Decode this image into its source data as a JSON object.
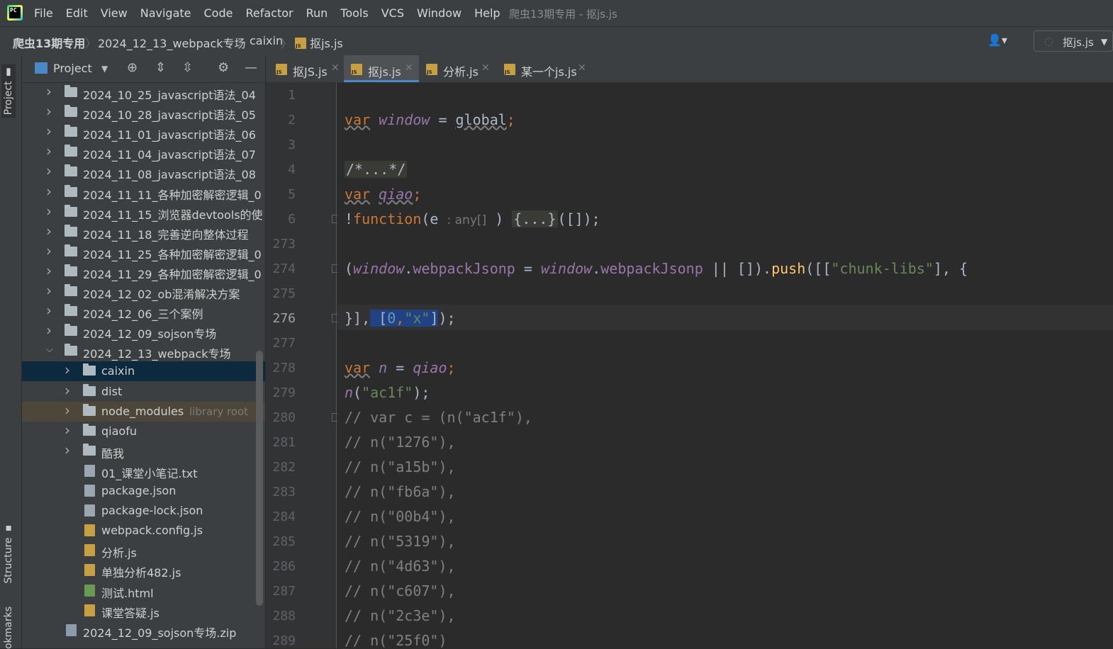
{
  "menubar": {
    "items": [
      "File",
      "Edit",
      "View",
      "Navigate",
      "Code",
      "Refactor",
      "Run",
      "Tools",
      "VCS",
      "Window",
      "Help"
    ],
    "window_title": "爬虫13期专用 - 抠js.js"
  },
  "navbar": {
    "breadcrumbs": [
      "爬虫13期专用",
      "2024_12_13_webpack专场",
      "caixin",
      "抠js.js"
    ],
    "run_config": "抠js.js"
  },
  "side_tabs": {
    "project": "Project",
    "structure": "Structure",
    "bookmarks": "okmarks"
  },
  "project_panel": {
    "title": "Project",
    "rows": [
      {
        "label": "2024_10_25_javascript语法_04",
        "type": "folder",
        "indent": 0,
        "expanded": false
      },
      {
        "label": "2024_10_28_javascript语法_05",
        "type": "folder",
        "indent": 0,
        "expanded": false
      },
      {
        "label": "2024_11_01_javascript语法_06",
        "type": "folder",
        "indent": 0,
        "expanded": false
      },
      {
        "label": "2024_11_04_javascript语法_07",
        "type": "folder",
        "indent": 0,
        "expanded": false
      },
      {
        "label": "2024_11_08_javascript语法_08",
        "type": "folder",
        "indent": 0,
        "expanded": false
      },
      {
        "label": "2024_11_11_各种加密解密逻辑_0",
        "type": "folder",
        "indent": 0,
        "expanded": false
      },
      {
        "label": "2024_11_15_浏览器devtools的使",
        "type": "folder",
        "indent": 0,
        "expanded": false
      },
      {
        "label": "2024_11_18_完善逆向整体过程",
        "type": "folder",
        "indent": 0,
        "expanded": false
      },
      {
        "label": "2024_11_25_各种加密解密逻辑_0",
        "type": "folder",
        "indent": 0,
        "expanded": false
      },
      {
        "label": "2024_11_29_各种加密解密逻辑_0",
        "type": "folder",
        "indent": 0,
        "expanded": false
      },
      {
        "label": "2024_12_02_ob混淆解决方案",
        "type": "folder",
        "indent": 0,
        "expanded": false
      },
      {
        "label": "2024_12_06_三个案例",
        "type": "folder",
        "indent": 0,
        "expanded": false
      },
      {
        "label": "2024_12_09_sojson专场",
        "type": "folder",
        "indent": 0,
        "expanded": false
      },
      {
        "label": "2024_12_13_webpack专场",
        "type": "folder",
        "indent": 0,
        "expanded": true
      },
      {
        "label": "caixin",
        "type": "folder",
        "indent": 1,
        "expanded": false,
        "selected": true
      },
      {
        "label": "dist",
        "type": "folder",
        "indent": 1,
        "expanded": false
      },
      {
        "label": "node_modules",
        "type": "folder",
        "indent": 1,
        "expanded": false,
        "hint": "library root",
        "lib": true
      },
      {
        "label": "qiaofu",
        "type": "folder",
        "indent": 1,
        "expanded": false
      },
      {
        "label": "酷我",
        "type": "folder",
        "indent": 1,
        "expanded": false
      },
      {
        "label": "01_课堂小笔记.txt",
        "type": "txt",
        "indent": 1
      },
      {
        "label": "package.json",
        "type": "json",
        "indent": 1
      },
      {
        "label": "package-lock.json",
        "type": "json",
        "indent": 1
      },
      {
        "label": "webpack.config.js",
        "type": "js",
        "indent": 1
      },
      {
        "label": "分析.js",
        "type": "js",
        "indent": 1
      },
      {
        "label": "单独分析482.js",
        "type": "js",
        "indent": 1
      },
      {
        "label": "测试.html",
        "type": "html",
        "indent": 1
      },
      {
        "label": "课堂答疑.js",
        "type": "js",
        "indent": 1
      },
      {
        "label": "2024_12_09_sojson专场.zip",
        "type": "zip",
        "indent": 0
      }
    ]
  },
  "tabs": [
    {
      "label": "抠JS.js",
      "active": false
    },
    {
      "label": "抠js.js",
      "active": true
    },
    {
      "label": "分析.js",
      "active": false
    },
    {
      "label": "某一个js.js",
      "active": false
    }
  ],
  "editor": {
    "line_numbers": [
      "1",
      "2",
      "3",
      "4",
      "5",
      "6",
      "273",
      "274",
      "275",
      "276",
      "277",
      "278",
      "279",
      "280",
      "281",
      "282",
      "283",
      "284",
      "285",
      "286",
      "287",
      "288",
      "289"
    ],
    "current_line": "276",
    "lines": {
      "l2": {
        "kw": "var",
        "name": "window",
        "op": " = ",
        "val": "global",
        "end": ";"
      },
      "l4": {
        "text": "/*...*/"
      },
      "l5": {
        "kw": "var",
        "name": "qiao",
        "end": ";"
      },
      "l6": {
        "bang": "!",
        "kw": "function",
        "open": "(e ",
        "hint": ": any[]",
        "close": " ) ",
        "fold": "{...}",
        "rest": "([]);"
      },
      "l274": {
        "p1": "(",
        "g1": "window",
        "d1": ".",
        "prop1": "webpackJsonp",
        "op": " = ",
        "g2": "window",
        "d2": ".",
        "prop2": "webpackJsonp",
        "p2": " || []).",
        "fn": "push",
        "p3": "([[",
        "str": "\"chunk-libs\"",
        "p4": "], {"
      },
      "l276": {
        "p1": "}],",
        "sel_a": " [",
        "sel_num": "0",
        "sel_comma": ",",
        "sel_str": "\"x\"",
        "sel_b": "]",
        "end": ");"
      },
      "l278": {
        "kw": "var",
        "name": "n",
        "op": " = ",
        "val": "qiao",
        "end": ";"
      },
      "l279": {
        "fn": "n",
        "p1": "(",
        "str": "\"ac1f\"",
        "p2": ");"
      },
      "comments": [
        "// var c = (n(\"ac1f\"),",
        "// n(\"1276\"),",
        "// n(\"a15b\"),",
        "// n(\"fb6a\"),",
        "// n(\"00b4\"),",
        "// n(\"5319\"),",
        "// n(\"4d63\"),",
        "// n(\"c607\"),",
        "// n(\"2c3e\"),",
        "// n(\"25f0\")"
      ]
    }
  }
}
